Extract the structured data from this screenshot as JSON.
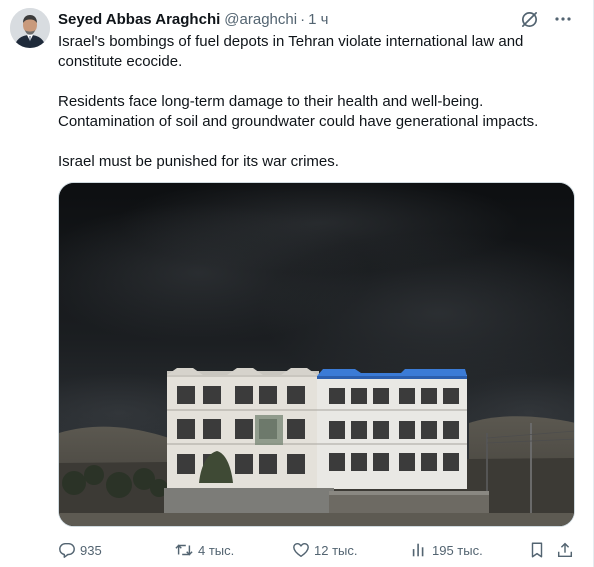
{
  "author": {
    "name": "Seyed Abbas Araghchi",
    "handle": "@araghchi",
    "separator": "·",
    "time": "1 ч"
  },
  "tweet": {
    "paragraphs": [
      "Israel's bombings of fuel depots in Tehran violate international law and constitute ecocide.",
      "Residents face long-term damage to their health and well-being. Contamination of soil and groundwater could have generational impacts.",
      "Israel must be punished for its war crimes."
    ]
  },
  "actions": {
    "replies": "935",
    "reposts": "4 тыс.",
    "likes": "12 тыс.",
    "views": "195 тыс."
  },
  "icons": {
    "grok": "grok-icon",
    "more": "more-icon",
    "reply": "reply-icon",
    "repost": "repost-icon",
    "like": "like-icon",
    "views": "views-icon",
    "bookmark": "bookmark-icon",
    "share": "share-icon"
  },
  "colors": {
    "text": "#0f1419",
    "secondary": "#536471",
    "roof_blue": "#3b7bd6"
  }
}
